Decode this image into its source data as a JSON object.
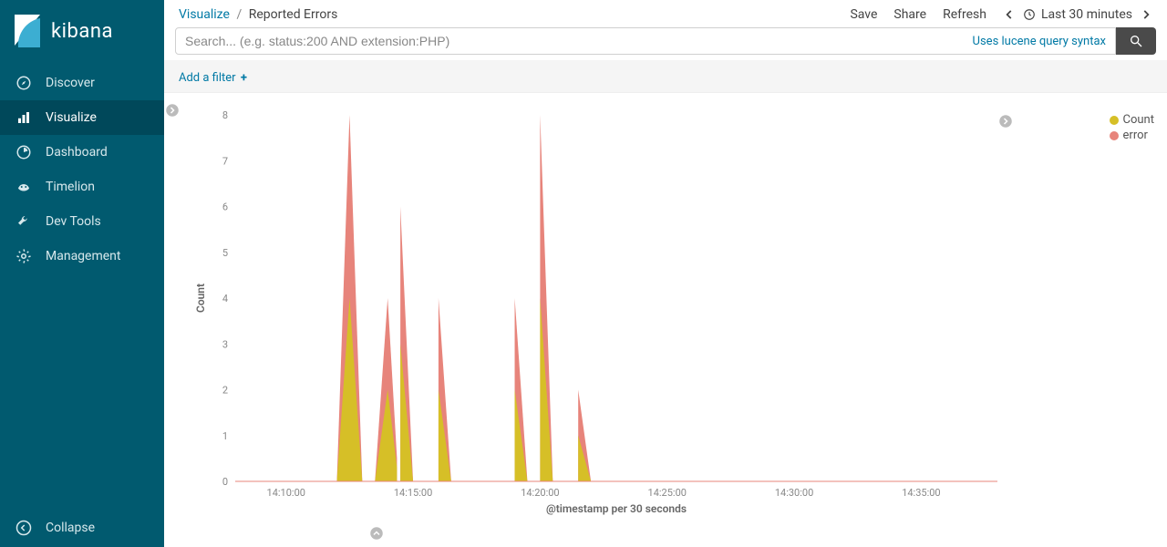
{
  "brand": {
    "name": "kibana"
  },
  "sidebar": {
    "items": [
      {
        "label": "Discover",
        "name": "sidebar-item-discover"
      },
      {
        "label": "Visualize",
        "name": "sidebar-item-visualize",
        "active": true
      },
      {
        "label": "Dashboard",
        "name": "sidebar-item-dashboard"
      },
      {
        "label": "Timelion",
        "name": "sidebar-item-timelion"
      },
      {
        "label": "Dev Tools",
        "name": "sidebar-item-dev-tools"
      },
      {
        "label": "Management",
        "name": "sidebar-item-management"
      }
    ],
    "collapse_label": "Collapse"
  },
  "breadcrumb": {
    "root": "Visualize",
    "leaf": "Reported Errors"
  },
  "topbar": {
    "save": "Save",
    "share": "Share",
    "refresh": "Refresh",
    "time_label": "Last 30 minutes"
  },
  "search": {
    "placeholder": "Search... (e.g. status:200 AND extension:PHP)",
    "lucene_link": "Uses lucene query syntax"
  },
  "filter": {
    "add_label": "Add a filter"
  },
  "legend": {
    "items": [
      {
        "label": "Count",
        "color": "#d6bf27"
      },
      {
        "label": "error",
        "color": "#e7847b"
      }
    ]
  },
  "chart": {
    "y_label": "Count",
    "x_label": "@timestamp per 30 seconds"
  },
  "chart_data": {
    "type": "area",
    "xlabel": "@timestamp per 30 seconds",
    "ylabel": "Count",
    "title": "Reported Errors",
    "ylim": [
      0,
      8
    ],
    "x_ticks": [
      "14:10:00",
      "14:15:00",
      "14:20:00",
      "14:25:00",
      "14:30:00",
      "14:35:00"
    ],
    "y_ticks": [
      0,
      1,
      2,
      3,
      4,
      5,
      6,
      7,
      8
    ],
    "x_start_sec": 50880,
    "x_end_sec": 52680,
    "series": [
      {
        "name": "error",
        "color": "#e7847b",
        "points": [
          [
            51120,
            0
          ],
          [
            51150,
            8
          ],
          [
            51180,
            0
          ],
          [
            51210,
            0
          ],
          [
            51240,
            4
          ],
          [
            51262,
            0.5
          ],
          [
            51270,
            6
          ],
          [
            51300,
            0
          ],
          [
            51330,
            0
          ],
          [
            51360,
            4
          ],
          [
            51390,
            0
          ],
          [
            51510,
            0
          ],
          [
            51540,
            4
          ],
          [
            51570,
            0
          ],
          [
            51570,
            0
          ],
          [
            51600,
            8
          ],
          [
            51630,
            0
          ],
          [
            51660,
            0
          ],
          [
            51690,
            2
          ],
          [
            51720,
            0
          ],
          [
            52410,
            0
          ],
          [
            52440,
            8
          ],
          [
            52470,
            0
          ]
        ]
      },
      {
        "name": "Count",
        "color": "#d6bf27",
        "points": [
          [
            51120,
            0
          ],
          [
            51150,
            4
          ],
          [
            51180,
            0
          ],
          [
            51210,
            0
          ],
          [
            51240,
            2
          ],
          [
            51262,
            0.3
          ],
          [
            51270,
            3
          ],
          [
            51300,
            0
          ],
          [
            51330,
            0
          ],
          [
            51360,
            2
          ],
          [
            51390,
            0
          ],
          [
            51510,
            0
          ],
          [
            51540,
            2
          ],
          [
            51570,
            0
          ],
          [
            51570,
            0
          ],
          [
            51600,
            4
          ],
          [
            51630,
            0
          ],
          [
            51660,
            0
          ],
          [
            51690,
            1
          ],
          [
            51720,
            0
          ],
          [
            52410,
            0
          ],
          [
            52440,
            4
          ],
          [
            52470,
            0
          ]
        ]
      }
    ]
  }
}
